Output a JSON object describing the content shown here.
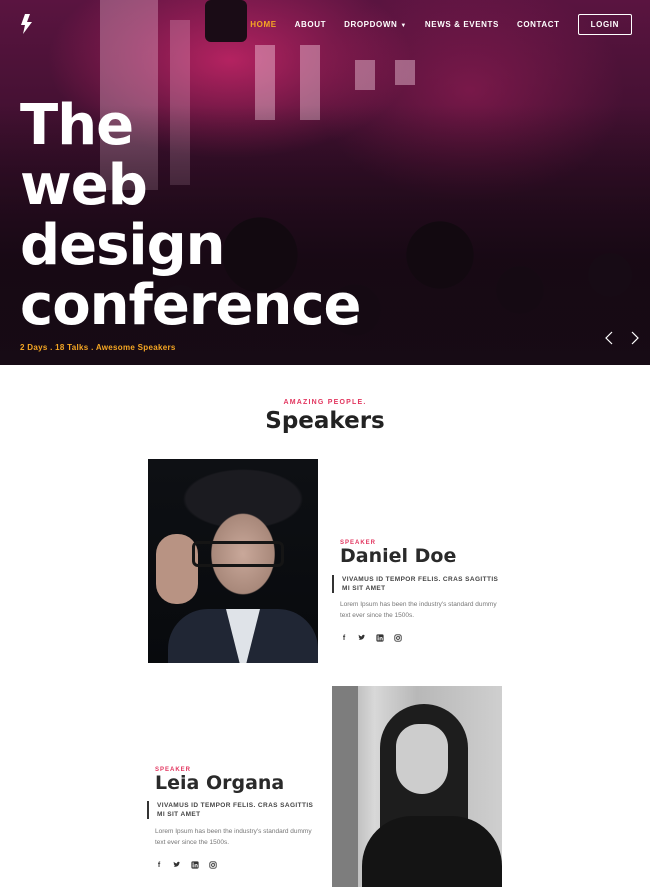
{
  "nav": {
    "items": [
      {
        "label": "HOME",
        "active": true
      },
      {
        "label": "ABOUT",
        "active": false
      },
      {
        "label": "DROPDOWN",
        "active": false,
        "has_caret": true
      },
      {
        "label": "NEWS & EVENTS",
        "active": false
      },
      {
        "label": "CONTACT",
        "active": false
      }
    ],
    "login_label": "LOGIN"
  },
  "hero": {
    "title_lines": [
      "The",
      "web",
      "design",
      "conference"
    ],
    "subtitle": "2 Days . 18 Talks . Awesome Speakers",
    "accent_color": "#f5a623"
  },
  "speakers_section": {
    "eyebrow": "AMAZING PEOPLE.",
    "title": "Speakers",
    "accent_color": "#e2365f",
    "speakers": [
      {
        "role": "SPEAKER",
        "name": "Daniel Doe",
        "quote": "VIVAMUS ID TEMPOR FELIS. CRAS SAGITTIS MI SIT AMET",
        "bio": "Lorem Ipsum has been the industry's standard dummy text ever since the 1500s.",
        "socials": [
          "facebook-icon",
          "twitter-icon",
          "linkedin-icon",
          "instagram-icon"
        ]
      },
      {
        "role": "SPEAKER",
        "name": "Leia Organa",
        "quote": "VIVAMUS ID TEMPOR FELIS. CRAS SAGITTIS MI SIT AMET",
        "bio": "Lorem Ipsum has been the industry's standard dummy text ever since the 1500s.",
        "socials": [
          "facebook-icon",
          "twitter-icon",
          "linkedin-icon",
          "instagram-icon"
        ]
      }
    ]
  }
}
